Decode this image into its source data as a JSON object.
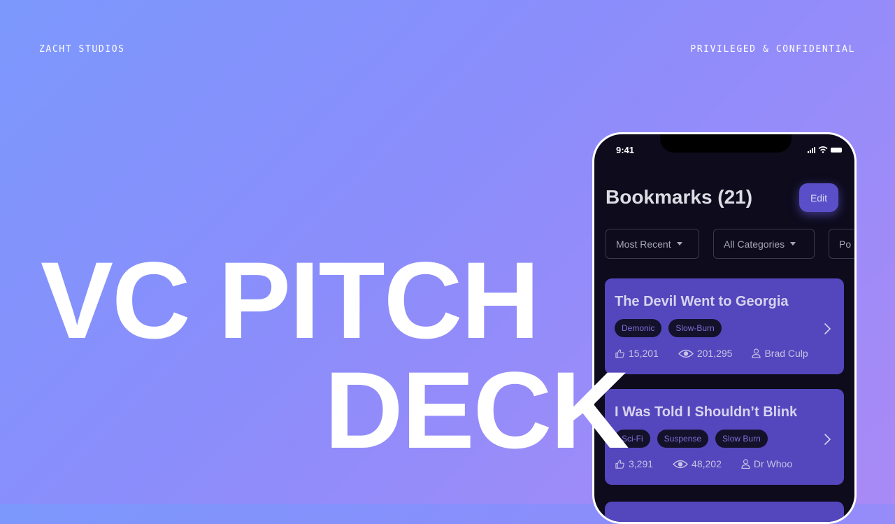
{
  "brand": "ZACHT STUDIOS",
  "confidential": "PRIVILEGED & CONFIDENTIAL",
  "title": {
    "line1": "VC PITCH",
    "line2": "DECK"
  },
  "phone": {
    "status_time": "9:41",
    "header_title": "Bookmarks (21)",
    "edit_label": "Edit",
    "filters": [
      "Most Recent",
      "All Categories",
      "Po"
    ],
    "cards": [
      {
        "title": "The Devil Went to Georgia",
        "tags": [
          "Demonic",
          "Slow-Burn"
        ],
        "likes": "15,201",
        "views": "201,295",
        "author": "Brad Culp"
      },
      {
        "title": "I Was Told I Shouldn’t Blink",
        "tags": [
          "Sci-Fi",
          "Suspense",
          "Slow Burn"
        ],
        "likes": "3,291",
        "views": "48,202",
        "author": "Dr Whoo"
      }
    ]
  },
  "colors": {
    "gradient_start": "#7c98fd",
    "gradient_end": "#a98af6",
    "phone_bg": "#0d0b1c",
    "card_bg": "#5446bc",
    "tag_bg": "#14112b",
    "accent": "#5a4fc9"
  },
  "icons": [
    "thumbs-up-icon",
    "eye-icon",
    "user-icon",
    "chevron-right-icon",
    "caret-down-icon",
    "signal-icon",
    "wifi-icon",
    "battery-icon"
  ]
}
